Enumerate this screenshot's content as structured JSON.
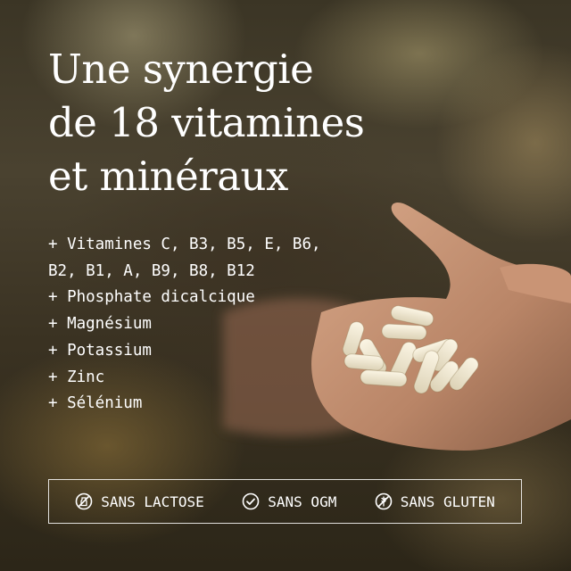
{
  "headline": {
    "line1": "Une synergie",
    "line2": "de 18 vitamines",
    "line3": "et minéraux"
  },
  "ingredients": [
    "+ Vitamines C, B3, B5, E, B6,",
    "B2, B1, A, B9, B8, B12",
    "+ Phosphate dicalcique",
    "+ Magnésium",
    "+ Potassium",
    "+ Zinc",
    "+ Sélénium"
  ],
  "badges": [
    {
      "label": "SANS LACTOSE",
      "icon": "no-lactose-icon"
    },
    {
      "label": "SANS OGM",
      "icon": "check-circle-icon"
    },
    {
      "label": "SANS GLUTEN",
      "icon": "no-gluten-icon"
    }
  ]
}
